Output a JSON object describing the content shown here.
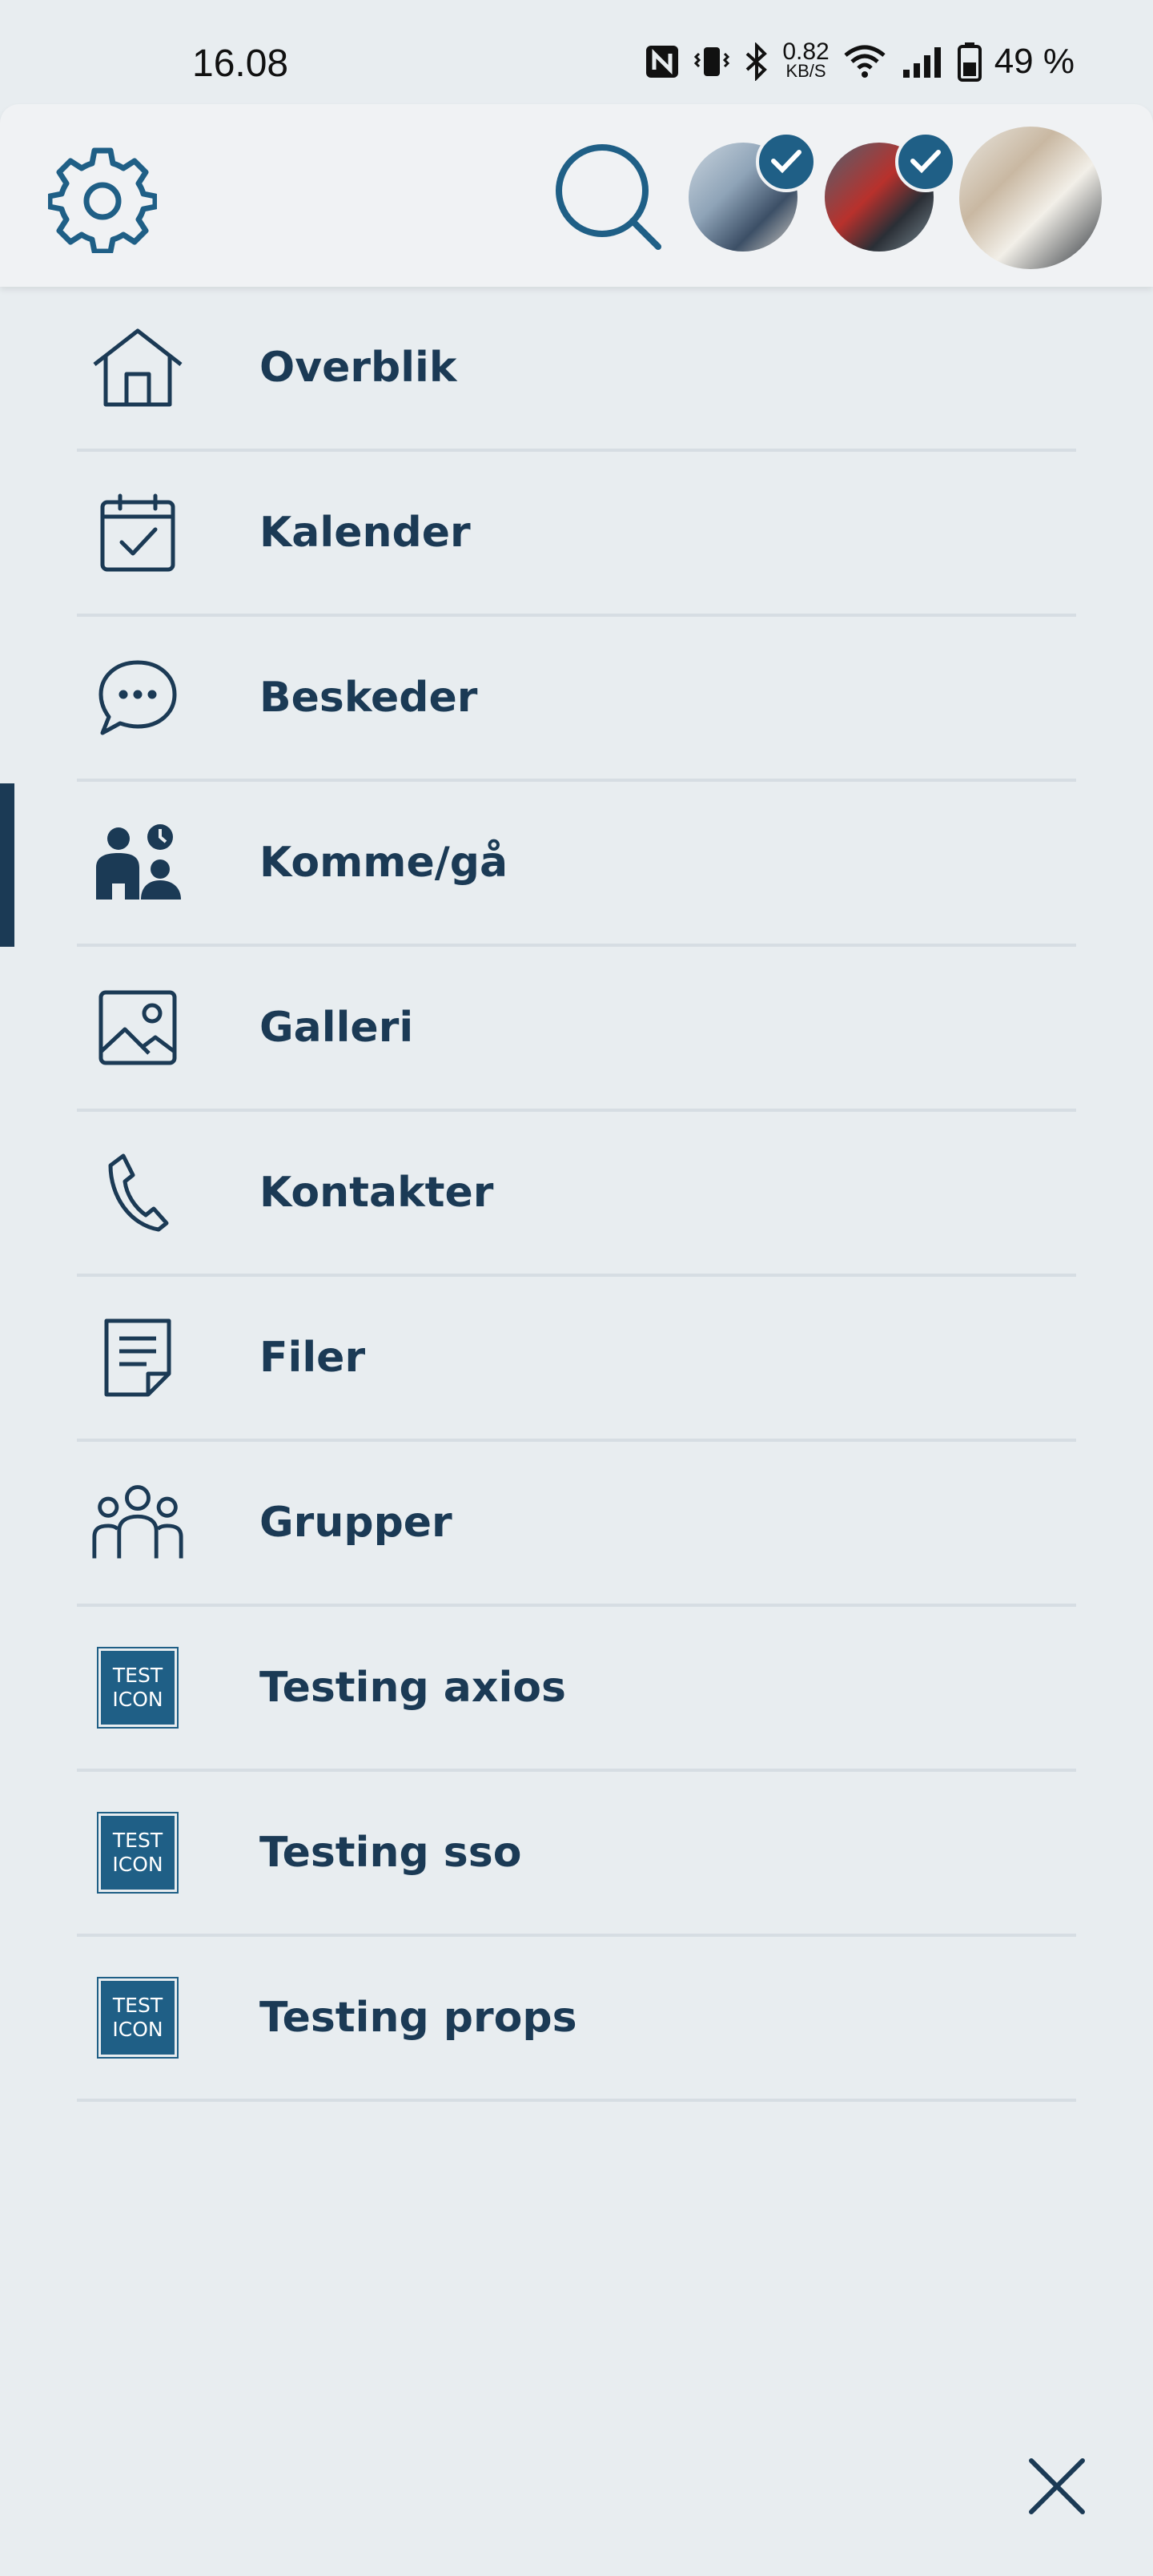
{
  "status_bar": {
    "time": "16.08",
    "net_speed_value": "0.82",
    "net_speed_unit": "KB/S",
    "battery_text": "49 %"
  },
  "header": {
    "settings_icon": "gear-icon",
    "search_icon": "search-icon",
    "avatars": [
      {
        "selected": true
      },
      {
        "selected": true
      },
      {
        "selected": false
      }
    ]
  },
  "menu": {
    "items": [
      {
        "label": "Overblik",
        "icon": "home-icon",
        "active": false
      },
      {
        "label": "Kalender",
        "icon": "calendar-check-icon",
        "active": false
      },
      {
        "label": "Beskeder",
        "icon": "chat-bubble-icon",
        "active": false
      },
      {
        "label": "Komme/gå",
        "icon": "people-clock-icon",
        "active": true
      },
      {
        "label": "Galleri",
        "icon": "image-icon",
        "active": false
      },
      {
        "label": "Kontakter",
        "icon": "phone-icon",
        "active": false
      },
      {
        "label": "Filer",
        "icon": "document-icon",
        "active": false
      },
      {
        "label": "Grupper",
        "icon": "group-icon",
        "active": false
      },
      {
        "label": "Testing axios",
        "icon": "test-icon",
        "active": false
      },
      {
        "label": "Testing sso",
        "icon": "test-icon",
        "active": false
      },
      {
        "label": "Testing props",
        "icon": "test-icon",
        "active": false
      }
    ],
    "test_icon_text": [
      "TEST",
      "ICON"
    ]
  },
  "colors": {
    "primary": "#1b3a55",
    "accent": "#1f5f86",
    "background": "#e8edf0",
    "divider": "#d6dde3"
  },
  "close_icon": "close-icon"
}
